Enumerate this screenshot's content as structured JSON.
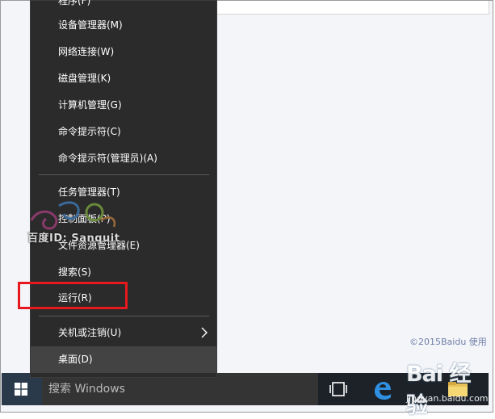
{
  "desktop": {
    "copyright": "©2015Baidu  使用"
  },
  "menu": {
    "top_partial": "程序(F)",
    "items": [
      {
        "label": "设备管理器(M)"
      },
      {
        "label": "网络连接(W)"
      },
      {
        "label": "磁盘管理(K)"
      },
      {
        "label": "计算机管理(G)"
      },
      {
        "label": "命令提示符(C)"
      },
      {
        "label": "命令提示符(管理员)(A)"
      },
      {
        "label": "任务管理器(T)"
      },
      {
        "label": "控制面板(P)"
      },
      {
        "label": "文件资源管理器(E)"
      },
      {
        "label": "搜索(S)"
      },
      {
        "label": "运行(R)"
      },
      {
        "label": "关机或注销(U)"
      },
      {
        "label": "桌面(D)"
      }
    ],
    "highlighted_item": "运行(R)",
    "selected_item": "桌面(D)"
  },
  "taskbar": {
    "search_placeholder": "搜索 Windows",
    "icons": [
      "windows-logo-icon",
      "task-view-icon",
      "edge-icon",
      "file-explorer-icon"
    ]
  },
  "watermarks": {
    "menu_overlay": "百度ID: Sanquit",
    "baidu_logo": "Bai 经验",
    "baidu_url": "jingyan.baidu.com"
  },
  "colors": {
    "menu_bg": "#2b2b2b",
    "taskbar_bg": "#1c2228",
    "highlight_border": "#e8191e",
    "desktop_bg": "#f4f5f9"
  }
}
